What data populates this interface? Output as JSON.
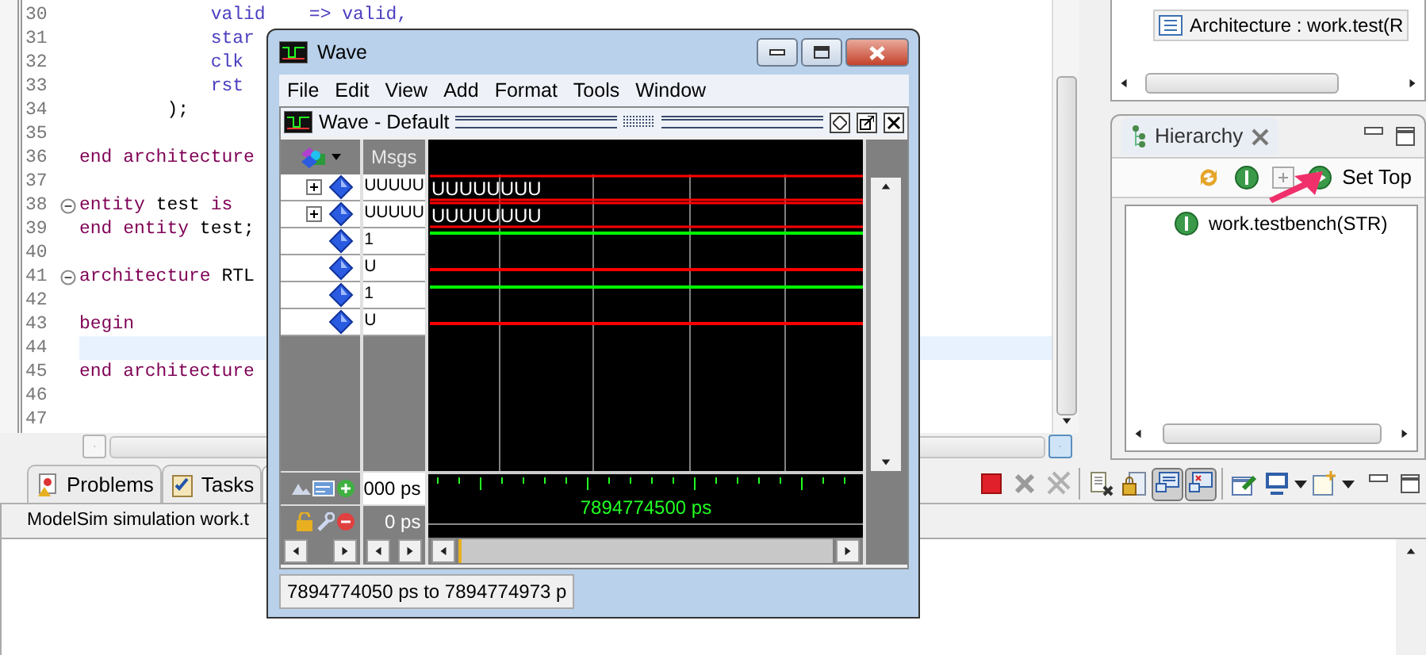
{
  "editor": {
    "lines": [
      {
        "number": "30",
        "tokens": [
          {
            "text": "            valid    => valid,",
            "kind": "port"
          }
        ],
        "foldable": false,
        "current": false
      },
      {
        "number": "31",
        "tokens": [
          {
            "text": "            star",
            "kind": "port"
          }
        ],
        "foldable": false,
        "current": false
      },
      {
        "number": "32",
        "tokens": [
          {
            "text": "            clk",
            "kind": "port"
          }
        ],
        "foldable": false,
        "current": false
      },
      {
        "number": "33",
        "tokens": [
          {
            "text": "            rst",
            "kind": "port"
          }
        ],
        "foldable": false,
        "current": false
      },
      {
        "number": "34",
        "tokens": [
          {
            "text": "        );",
            "kind": "plain"
          }
        ],
        "foldable": false,
        "current": false
      },
      {
        "number": "35",
        "foldable": false,
        "current": false
      },
      {
        "number": "36",
        "tokens": [
          {
            "text": "end architecture",
            "kind": "keyword"
          }
        ],
        "foldable": false,
        "current": false
      },
      {
        "number": "37",
        "foldable": false,
        "current": false
      },
      {
        "number": "38",
        "tokens": [
          {
            "text": "entity",
            "kind": "keyword"
          },
          {
            "text": " test ",
            "kind": "plain"
          },
          {
            "text": "is",
            "kind": "keyword"
          }
        ],
        "foldable": true,
        "current": false
      },
      {
        "number": "39",
        "tokens": [
          {
            "text": "end entity",
            "kind": "keyword"
          },
          {
            "text": " test;",
            "kind": "plain"
          }
        ],
        "foldable": false,
        "current": false
      },
      {
        "number": "40",
        "foldable": false,
        "current": false
      },
      {
        "number": "41",
        "tokens": [
          {
            "text": "architecture",
            "kind": "keyword"
          },
          {
            "text": " RTL",
            "kind": "plain"
          }
        ],
        "foldable": true,
        "current": false
      },
      {
        "number": "42",
        "foldable": false,
        "current": false
      },
      {
        "number": "43",
        "tokens": [
          {
            "text": "begin",
            "kind": "keyword"
          }
        ],
        "foldable": false,
        "current": false
      },
      {
        "number": "44",
        "foldable": false,
        "current": true
      },
      {
        "number": "45",
        "tokens": [
          {
            "text": "end architecture",
            "kind": "keyword"
          }
        ],
        "foldable": false,
        "current": false
      },
      {
        "number": "46",
        "foldable": false,
        "current": false
      },
      {
        "number": "47",
        "foldable": false,
        "current": false
      }
    ]
  },
  "outline": {
    "items": [
      {
        "label": "Architecture : work.test(R",
        "selected": true
      }
    ]
  },
  "hierarchy": {
    "tab": "Hierarchy",
    "set_top": "Set Top",
    "tree": [
      {
        "label": "work.testbench(STR)"
      }
    ]
  },
  "bottom": {
    "tabs": [
      {
        "label": "Problems",
        "kind": "problems",
        "selected": false
      },
      {
        "label": "Tasks",
        "kind": "tasks",
        "selected": false
      },
      {
        "kind": "console",
        "selected": true
      }
    ],
    "console_text": "ModelSim simulation work.t",
    "toolbar": [
      {
        "kind": "stop",
        "pressed": false
      },
      {
        "kind": "remove",
        "pressed": false
      },
      {
        "kind": "remove-all",
        "pressed": false
      },
      {
        "kind": "sep"
      },
      {
        "kind": "clear",
        "pressed": false
      },
      {
        "kind": "scroll-lock",
        "pressed": false
      },
      {
        "kind": "monitor",
        "pressed": true
      },
      {
        "kind": "monitor-error",
        "pressed": true
      },
      {
        "kind": "sep"
      },
      {
        "kind": "pin",
        "pressed": false
      },
      {
        "kind": "display",
        "pressed": false
      },
      {
        "kind": "caret"
      },
      {
        "kind": "new-window",
        "pressed": false
      },
      {
        "kind": "caret"
      }
    ]
  },
  "wave_window": {
    "title": "Wave",
    "menu": [
      "File",
      "Edit",
      "View",
      "Add",
      "Format",
      "Tools",
      "Window"
    ],
    "pane_title": "Wave - Default",
    "msgs_header": "Msgs",
    "signals": [
      {
        "kind": "bus",
        "expandable": true,
        "value": "UUUUU",
        "wave_label": "UUUUUUUU",
        "color": "#ff0000"
      },
      {
        "kind": "bus",
        "expandable": true,
        "value": "UUUUU",
        "wave_label": "UUUUUUUU",
        "color": "#ff0000"
      },
      {
        "kind": "high",
        "expandable": false,
        "value": "1",
        "color": "#00ff00"
      },
      {
        "kind": "middle",
        "expandable": false,
        "value": "U",
        "color": "#ff0000"
      },
      {
        "kind": "high",
        "expandable": false,
        "value": "1",
        "color": "#00ff00"
      },
      {
        "kind": "middle",
        "expandable": false,
        "value": "U",
        "color": "#ff0000"
      }
    ],
    "cursor_rows": [
      {
        "time": "000 ps",
        "kind": "now"
      },
      {
        "time": "0 ps",
        "kind": "cursor"
      }
    ],
    "cursor_label": "7894774500 ps",
    "status": "7894774050 ps to 7894774973 p"
  }
}
